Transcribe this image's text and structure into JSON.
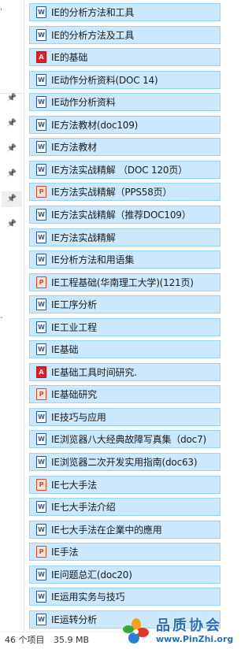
{
  "nav_pane": {
    "marks": [
      ",",
      "-"
    ],
    "pin_count": 6,
    "selected_pin": 4
  },
  "files": [
    {
      "name": "IE的分析方法和工具",
      "type": "word"
    },
    {
      "name": "IE的分析方法及工具",
      "type": "word"
    },
    {
      "name": "IE的基础",
      "type": "pdf"
    },
    {
      "name": "IE动作分析资料(DOC 14)",
      "type": "word"
    },
    {
      "name": "IE动作分析资料",
      "type": "word"
    },
    {
      "name": "IE方法教材(doc109)",
      "type": "word"
    },
    {
      "name": "IE方法教材",
      "type": "word"
    },
    {
      "name": "IE方法实战精解 （DOC 120页）",
      "type": "word"
    },
    {
      "name": "IE方法实战精解（PPS58页）",
      "type": "ppt"
    },
    {
      "name": "IE方法实战精解（推荐DOC109）",
      "type": "word"
    },
    {
      "name": "IE方法实战精解",
      "type": "word"
    },
    {
      "name": "IE分析方法和用语集",
      "type": "word"
    },
    {
      "name": "IE工程基础(华南理工大学)(121页)",
      "type": "ppt"
    },
    {
      "name": "IE工序分析",
      "type": "word"
    },
    {
      "name": "IE工业工程",
      "type": "word"
    },
    {
      "name": "IE基础",
      "type": "word"
    },
    {
      "name": "IE基础工具时间研究.",
      "type": "pdf"
    },
    {
      "name": "IE基础研究",
      "type": "ppt"
    },
    {
      "name": "IE技巧与应用",
      "type": "word"
    },
    {
      "name": "IE浏览器八大经典故障写真集（doc7)",
      "type": "word"
    },
    {
      "name": "IE浏览器二次开发实用指南(doc63)",
      "type": "word"
    },
    {
      "name": "IE七大手法",
      "type": "ppt"
    },
    {
      "name": "IE七大手法介绍",
      "type": "word"
    },
    {
      "name": "IE七大手法在企業中的應用",
      "type": "word"
    },
    {
      "name": "IE手法",
      "type": "ppt"
    },
    {
      "name": "IE问题总汇(doc20)",
      "type": "word"
    },
    {
      "name": "IE运用实务与技巧",
      "type": "word"
    },
    {
      "name": "IE运转分析",
      "type": "word"
    }
  ],
  "status_bar": {
    "item_count": "46 个项目",
    "size": "35.9 MB"
  },
  "watermark": {
    "title": "品质协会",
    "url": "www.PinZhi.org"
  },
  "colors": {
    "selection_bg": "#cce8ff",
    "selection_border": "#99d1ff",
    "word": "#2b579a",
    "ppt": "#d24726",
    "pdf": "#e02020",
    "watermark": "#2a6db5"
  }
}
